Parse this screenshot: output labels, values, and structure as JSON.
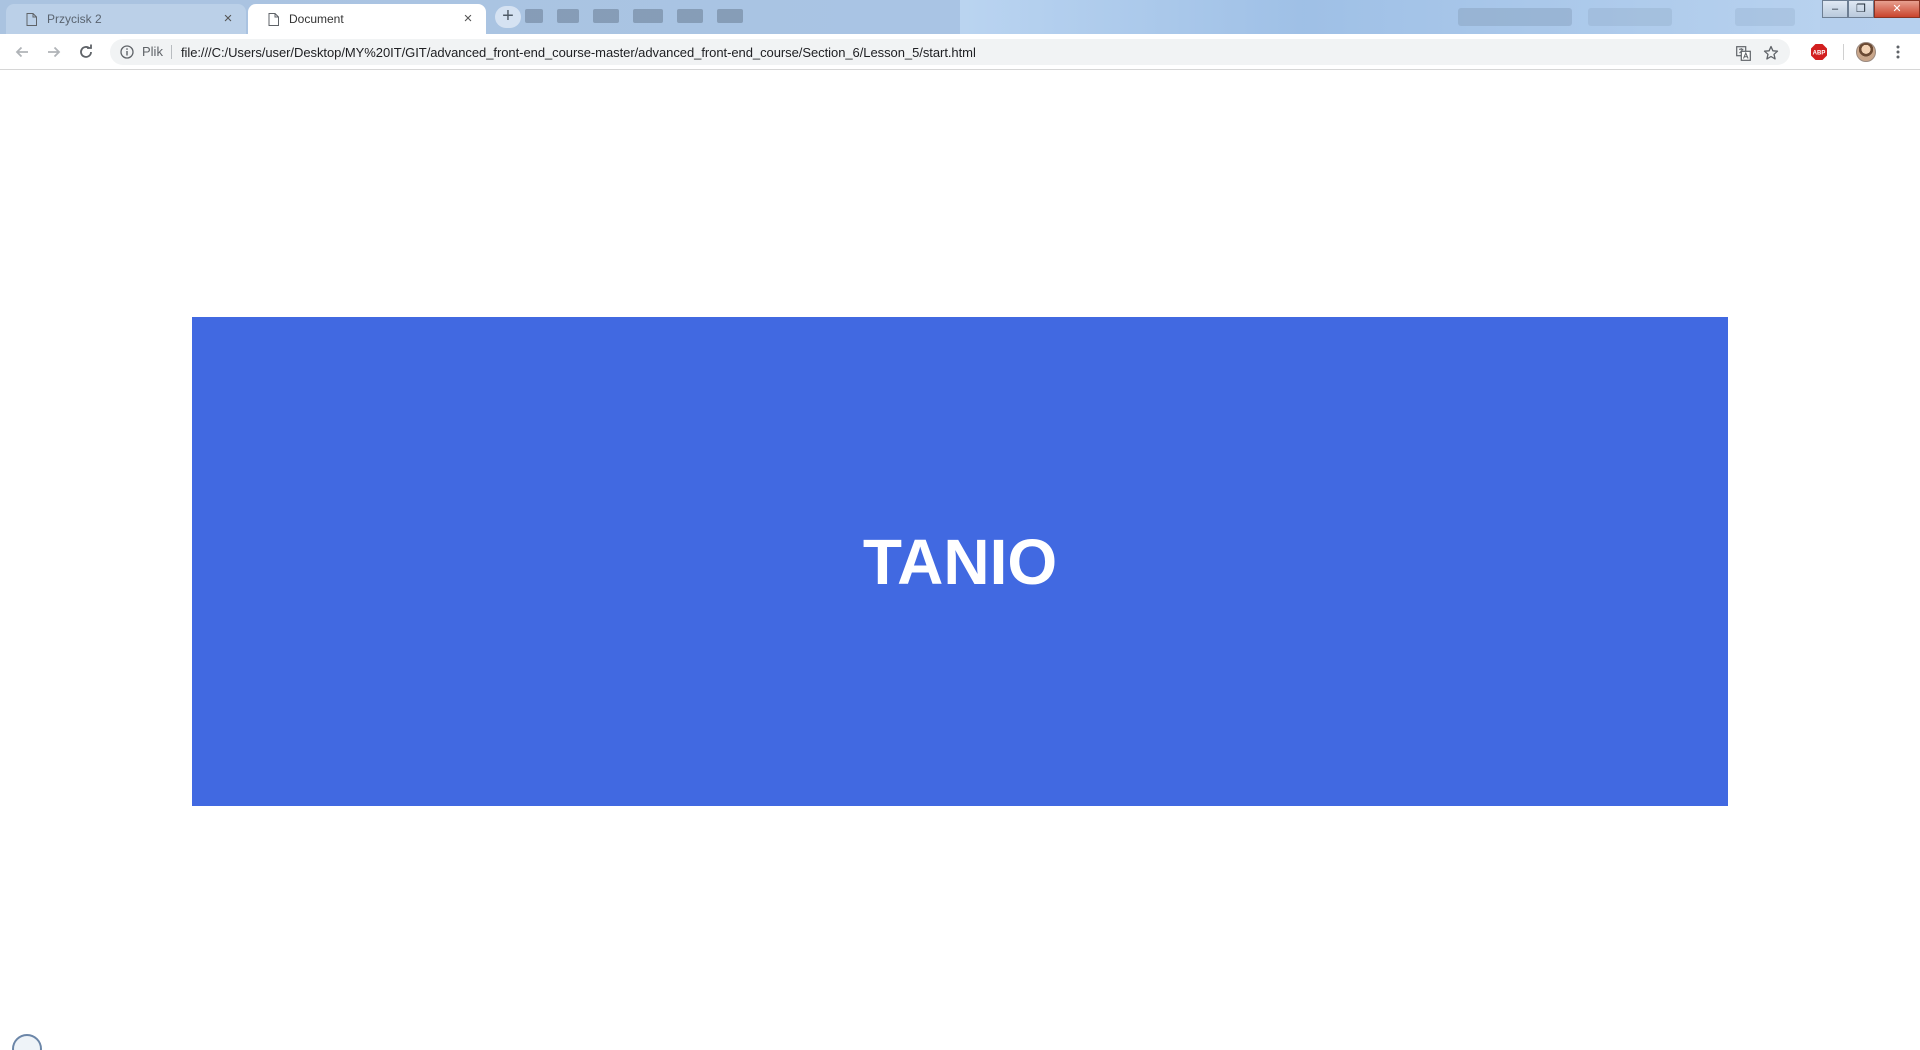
{
  "browser": {
    "tabs": [
      {
        "title": "Przycisk 2",
        "active": false
      },
      {
        "title": "Document",
        "active": true
      }
    ],
    "new_tab_icon": "plus-icon",
    "close_glyph": "×",
    "window_controls": {
      "minimize": "–",
      "restore": "❐",
      "close": "✕"
    },
    "address_bar": {
      "scheme_label": "Plik",
      "url": "file:///C:/Users/user/Desktop/MY%20IT/GIT/advanced_front-end_course-master/advanced_front-end_course/Section_6/Lesson_5/start.html"
    },
    "icons": {
      "back": "arrow-left-icon",
      "forward": "arrow-right-icon",
      "reload": "reload-icon",
      "info": "info-icon",
      "translate": "translate-icon",
      "bookmark": "star-icon",
      "extension": "adblock-plus-icon",
      "profile": "avatar",
      "menu": "kebab-menu-icon"
    },
    "extension_label": "ABP"
  },
  "page": {
    "promo_text": "TANIO",
    "colors": {
      "box_background": "#4169e1",
      "text": "#ffffff"
    }
  }
}
